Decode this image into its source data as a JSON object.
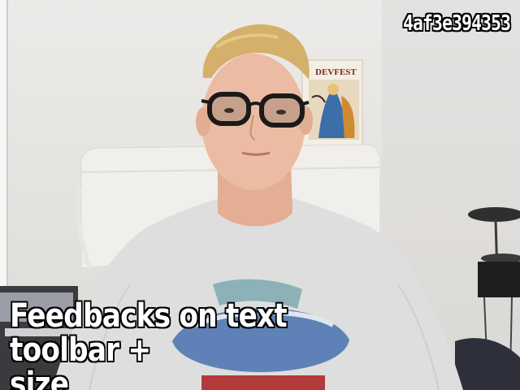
{
  "overlay": {
    "video_id": "4af3e394353",
    "caption_line1": "Feedbacks on text toolbar +",
    "caption_line2": "size"
  },
  "poster": {
    "heading": "DEVFEST"
  },
  "colors": {
    "wall": "#e6e4e2",
    "shirt": "#dcdcdc",
    "chair": "#f1f0ec",
    "hair": "#d4b06a",
    "skin": "#e8b9a0",
    "glasses": "#1b1a19",
    "caption_text": "#ffffff",
    "caption_outline": "#000000"
  }
}
